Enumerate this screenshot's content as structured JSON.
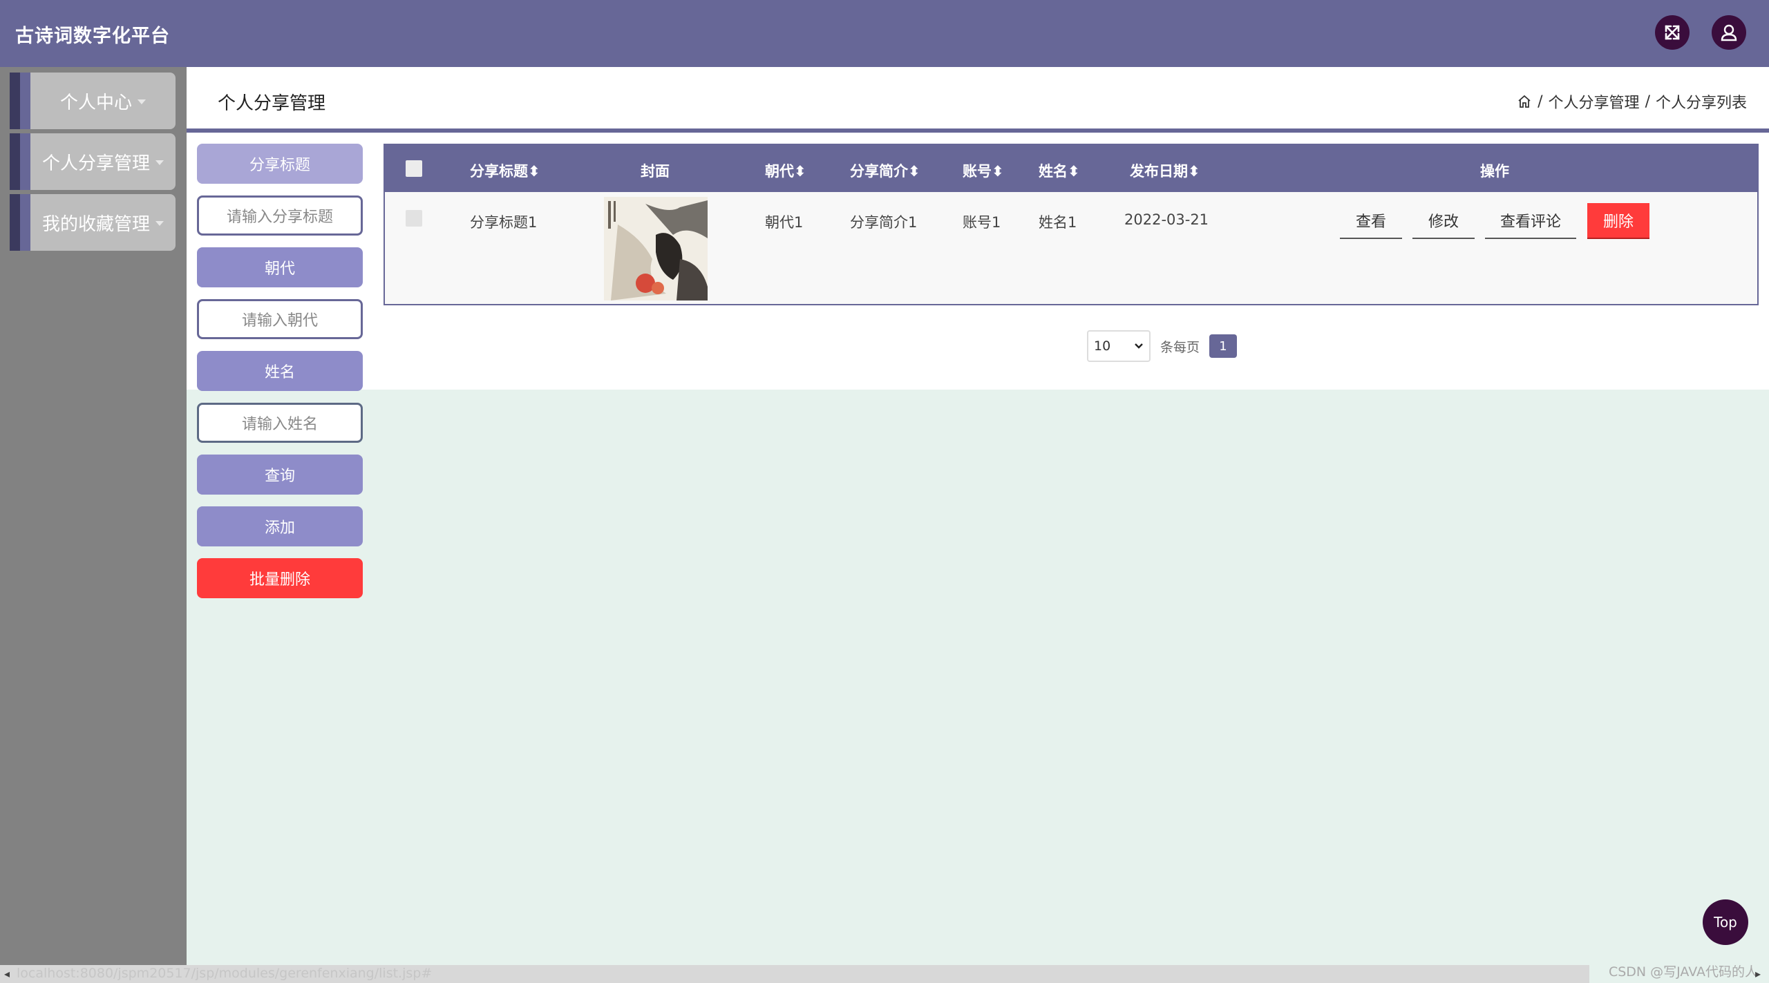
{
  "header": {
    "title": "古诗词数字化平台"
  },
  "sidebar": {
    "items": [
      {
        "label": "个人中心"
      },
      {
        "label": "个人分享管理"
      },
      {
        "label": "我的收藏管理"
      }
    ]
  },
  "page": {
    "title": "个人分享管理",
    "breadcrumb": [
      "个人分享管理",
      "个人分享列表"
    ],
    "breadcrumb_sep": "/"
  },
  "search": {
    "title_label": "分享标题",
    "title_placeholder": "请输入分享标题",
    "dynasty_label": "朝代",
    "dynasty_placeholder": "请输入朝代",
    "name_label": "姓名",
    "name_placeholder": "请输入姓名",
    "query_button": "查询",
    "add_button": "添加",
    "batch_delete_button": "批量删除"
  },
  "table": {
    "columns": [
      "分享标题",
      "封面",
      "朝代",
      "分享简介",
      "账号",
      "姓名",
      "发布日期",
      "操作"
    ],
    "rows": [
      {
        "title": "分享标题1",
        "dynasty": "朝代1",
        "intro": "分享简介1",
        "account": "账号1",
        "name": "姓名1",
        "date": "2022-03-21"
      }
    ],
    "actions": {
      "view": "查看",
      "edit": "修改",
      "comments": "查看评论",
      "delete": "删除"
    }
  },
  "pagination": {
    "page_size": "10",
    "per_page_label": "条每页",
    "current_page": "1"
  },
  "top_button": "Top",
  "status_url": "localhost:8080/jspm20517/jsp/modules/gerenfenxiang/list.jsp#",
  "watermark": "CSDN @写JAVA代码的人",
  "colors": {
    "header": "#676797",
    "sidebar": "#828282",
    "accent_dark": "#3a0d3c",
    "search_label_bg": "#a9a6d6",
    "button_bg": "#8e8cc9",
    "danger": "#ff3b3b",
    "content_bg": "#e6f2ed"
  }
}
